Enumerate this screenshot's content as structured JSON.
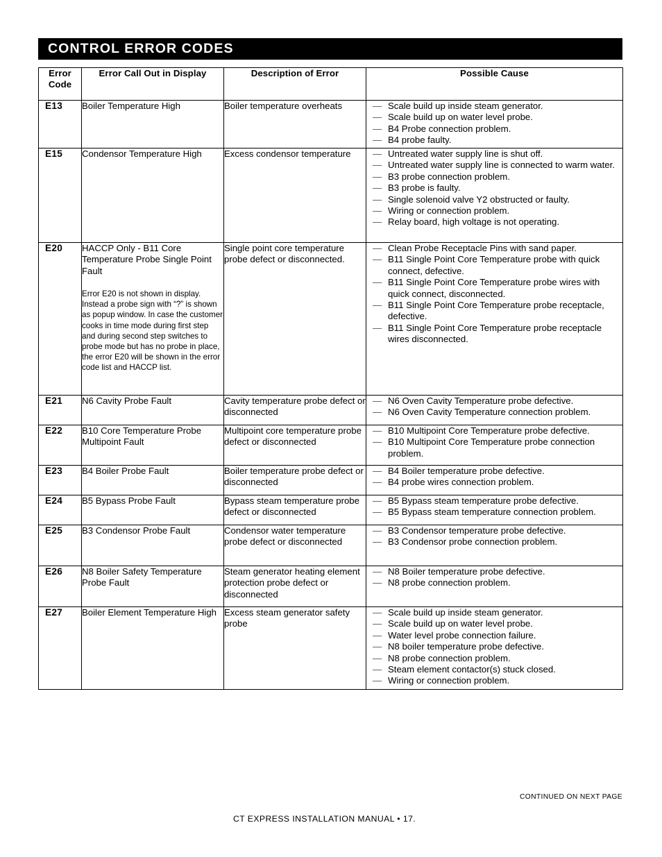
{
  "banner": {
    "title": "CONTROL ERROR CODES"
  },
  "table": {
    "headers": {
      "code": "Error\nCode",
      "code_line1": "Error",
      "code_line2": "Code",
      "call_out": "Error Call Out in Display",
      "description": "Description of Error",
      "possible_cause": "Possible Cause"
    },
    "rows": [
      {
        "code": "E13",
        "call_out": "Boiler Temperature High",
        "description": "Boiler temperature overheats",
        "causes": [
          "Scale build up inside steam generator.",
          "Scale build up on water level probe.",
          "B4 Probe connection problem.",
          "B4 probe faulty."
        ]
      },
      {
        "code": "E15",
        "call_out": "Condensor Temperature High",
        "description": "Excess condensor temperature",
        "causes": [
          "Untreated water supply line is shut off.",
          "Untreated water supply line is connected to warm water.",
          "B3 probe connection problem.",
          "B3 probe is faulty.",
          "Single solenoid valve Y2 obstructed or faulty.",
          "Wiring or connection problem.",
          "Relay board, high voltage is not operating."
        ]
      },
      {
        "code": "E20",
        "call_out": "HACCP Only - B11 Core Temperature Probe Single Point Fault",
        "note": "Error E20 is not shown in display. Instead a probe sign with “?” is shown as popup window.  In case the customer cooks in time mode during first step and during second step switches to probe mode but has no probe in place, the error E20 will be shown in the error code list and HACCP list.",
        "description": "Single point core temperature probe defect or disconnected.",
        "causes": [
          "Clean Probe Receptacle Pins with sand paper.",
          "B11 Single Point Core Temperature probe with quick connect, defective.",
          "B11 Single Point Core Temperature probe wires with quick connect, disconnected.",
          "B11 Single Point Core Temperature probe receptacle, defective.",
          "B11 Single Point Core Temperature probe receptacle wires disconnected."
        ]
      },
      {
        "code": "E21",
        "call_out": "N6 Cavity Probe Fault",
        "description": "Cavity temperature probe defect or disconnected",
        "causes": [
          "N6 Oven Cavity Temperature probe defective.",
          "N6 Oven Cavity Temperature connection problem."
        ]
      },
      {
        "code": "E22",
        "call_out": "B10 Core Temperature Probe Multipoint Fault",
        "description": "Multipoint core temperature probe defect or disconnected",
        "causes": [
          "B10 Multipoint Core Temperature probe defective.",
          "B10 Multipoint Core Temperature probe connection problem."
        ]
      },
      {
        "code": "E23",
        "call_out": "B4 Boiler Probe Fault",
        "description": "Boiler temperature probe defect or disconnected",
        "causes": [
          "B4 Boiler temperature probe defective.",
          "B4 probe wires connection problem."
        ]
      },
      {
        "code": "E24",
        "call_out": "B5 Bypass Probe Fault",
        "description": "Bypass steam temperature probe defect or disconnected",
        "causes": [
          "B5 Bypass steam temperature probe defective.",
          "B5 Bypass steam temperature connection problem."
        ]
      },
      {
        "code": "E25",
        "call_out": "B3 Condensor Probe Fault",
        "description": "Condensor water temperature probe defect or disconnected",
        "causes": [
          "B3 Condensor temperature probe defective.",
          "B3 Condensor probe connection problem."
        ]
      },
      {
        "code": "E26",
        "call_out": "N8 Boiler Safety Temperature Probe Fault",
        "description": "Steam generator heating element protection probe defect or disconnected",
        "causes": [
          "N8 Boiler temperature probe defective.",
          "N8 probe connection problem."
        ]
      },
      {
        "code": "E27",
        "call_out": "Boiler Element Temperature High",
        "description": "Excess steam generator safety probe",
        "causes": [
          "Scale build up inside steam generator.",
          "Scale build up on water level probe.",
          "Water level probe connection failure.",
          "N8 boiler temperature probe defective.",
          "N8 probe connection problem.",
          "Steam element contactor(s) stuck closed.",
          "Wiring or connection problem."
        ]
      }
    ]
  },
  "footer": {
    "continued": "CONTINUED ON NEXT PAGE",
    "manual_line": "CT EXPRESS INSTALLATION MANUAL • 17."
  },
  "colors": {
    "banner_background": "#000000",
    "banner_text": "#ffffff",
    "page_background": "#ffffff",
    "text": "#000000",
    "rule": "#000000",
    "bullet_dash": "#555555"
  }
}
